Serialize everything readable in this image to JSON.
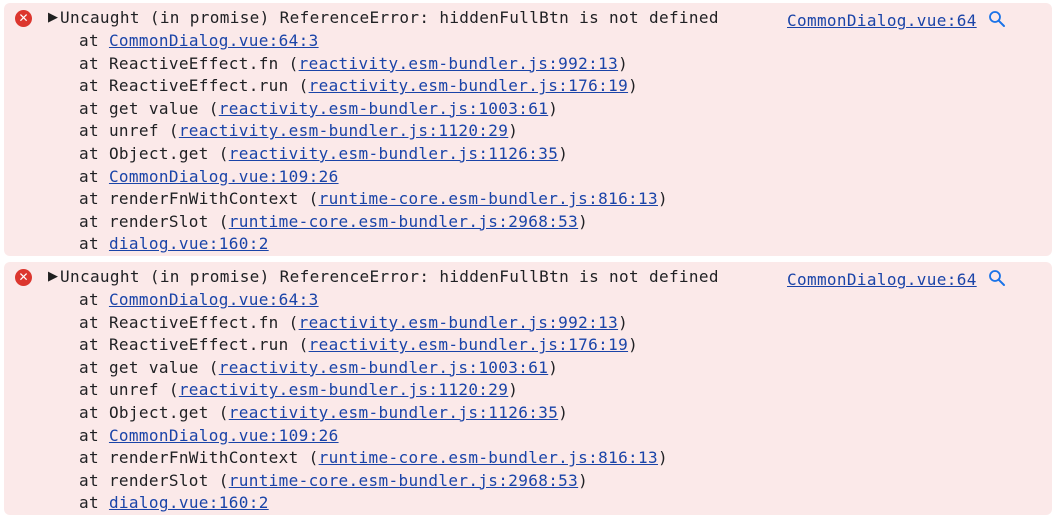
{
  "errors": [
    {
      "message": "Uncaught (in promise) ReferenceError: hiddenFullBtn is not defined",
      "source": "CommonDialog.vue:64",
      "frames": [
        {
          "prefix": "at ",
          "link": "CommonDialog.vue:64:3",
          "suffix": ""
        },
        {
          "prefix": "at ReactiveEffect.fn (",
          "link": "reactivity.esm-bundler.js:992:13",
          "suffix": ")"
        },
        {
          "prefix": "at ReactiveEffect.run (",
          "link": "reactivity.esm-bundler.js:176:19",
          "suffix": ")"
        },
        {
          "prefix": "at get value (",
          "link": "reactivity.esm-bundler.js:1003:61",
          "suffix": ")"
        },
        {
          "prefix": "at unref (",
          "link": "reactivity.esm-bundler.js:1120:29",
          "suffix": ")"
        },
        {
          "prefix": "at Object.get (",
          "link": "reactivity.esm-bundler.js:1126:35",
          "suffix": ")"
        },
        {
          "prefix": "at ",
          "link": "CommonDialog.vue:109:26",
          "suffix": ""
        },
        {
          "prefix": "at renderFnWithContext (",
          "link": "runtime-core.esm-bundler.js:816:13",
          "suffix": ")"
        },
        {
          "prefix": "at renderSlot (",
          "link": "runtime-core.esm-bundler.js:2968:53",
          "suffix": ")"
        },
        {
          "prefix": "at ",
          "link": "dialog.vue:160:2",
          "suffix": ""
        }
      ]
    },
    {
      "message": "Uncaught (in promise) ReferenceError: hiddenFullBtn is not defined",
      "source": "CommonDialog.vue:64",
      "frames": [
        {
          "prefix": "at ",
          "link": "CommonDialog.vue:64:3",
          "suffix": ""
        },
        {
          "prefix": "at ReactiveEffect.fn (",
          "link": "reactivity.esm-bundler.js:992:13",
          "suffix": ")"
        },
        {
          "prefix": "at ReactiveEffect.run (",
          "link": "reactivity.esm-bundler.js:176:19",
          "suffix": ")"
        },
        {
          "prefix": "at get value (",
          "link": "reactivity.esm-bundler.js:1003:61",
          "suffix": ")"
        },
        {
          "prefix": "at unref (",
          "link": "reactivity.esm-bundler.js:1120:29",
          "suffix": ")"
        },
        {
          "prefix": "at Object.get (",
          "link": "reactivity.esm-bundler.js:1126:35",
          "suffix": ")"
        },
        {
          "prefix": "at ",
          "link": "CommonDialog.vue:109:26",
          "suffix": ""
        },
        {
          "prefix": "at renderFnWithContext (",
          "link": "runtime-core.esm-bundler.js:816:13",
          "suffix": ")"
        },
        {
          "prefix": "at renderSlot (",
          "link": "runtime-core.esm-bundler.js:2968:53",
          "suffix": ")"
        },
        {
          "prefix": "at ",
          "link": "dialog.vue:160:2",
          "suffix": ""
        }
      ]
    }
  ],
  "icons": {
    "error": "error-icon",
    "expand": "triangle-right-icon",
    "search": "search-icon"
  },
  "colors": {
    "error_background": "#fbe9e9",
    "error_icon": "#dc362e",
    "link": "#1a44a8"
  }
}
